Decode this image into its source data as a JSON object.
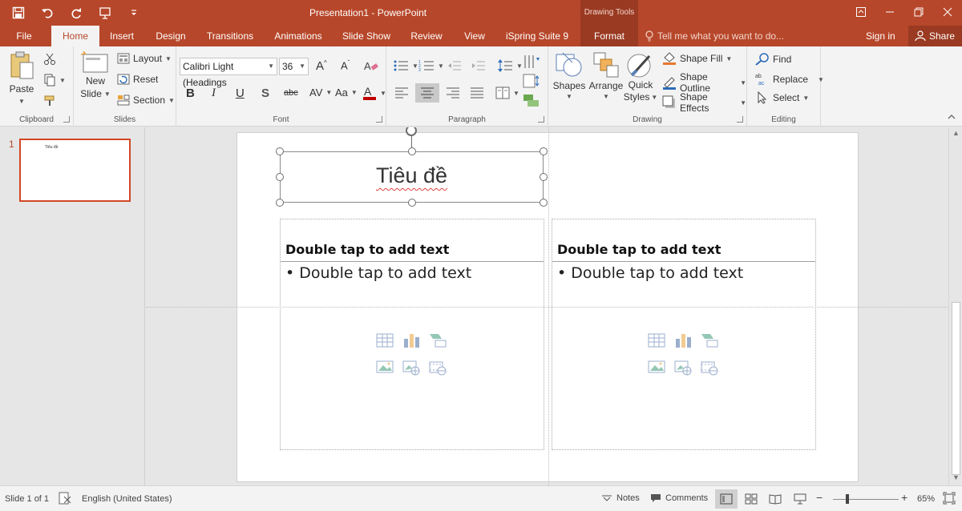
{
  "window": {
    "title": "Presentation1 - PowerPoint",
    "contextual_header": "Drawing Tools",
    "accent": "#b7472a"
  },
  "tabs": [
    {
      "label": "File"
    },
    {
      "label": "Home"
    },
    {
      "label": "Insert"
    },
    {
      "label": "Design"
    },
    {
      "label": "Transitions"
    },
    {
      "label": "Animations"
    },
    {
      "label": "Slide Show"
    },
    {
      "label": "Review"
    },
    {
      "label": "View"
    },
    {
      "label": "iSpring Suite 9"
    },
    {
      "label": "Format"
    }
  ],
  "tell_me": "Tell me what you want to do...",
  "sign_in": "Sign in",
  "share": "Share",
  "ribbon": {
    "clipboard": {
      "label": "Clipboard",
      "paste": "Paste"
    },
    "slides": {
      "label": "Slides",
      "new_slide_1": "New",
      "new_slide_2": "Slide",
      "layout": "Layout",
      "reset": "Reset",
      "section": "Section"
    },
    "font": {
      "label": "Font",
      "font_name": "Calibri Light (Headings",
      "font_size": "36",
      "underline_color": "#c00000"
    },
    "paragraph": {
      "label": "Paragraph"
    },
    "drawing": {
      "label": "Drawing",
      "shapes": "Shapes",
      "arrange": "Arrange",
      "quick_1": "Quick",
      "quick_2": "Styles",
      "shape_fill": "Shape Fill",
      "shape_outline": "Shape Outline",
      "shape_effects": "Shape Effects"
    },
    "editing": {
      "label": "Editing",
      "find": "Find",
      "replace": "Replace",
      "select": "Select"
    }
  },
  "thumbnails": [
    {
      "number": "1",
      "title": "Tiêu đề"
    }
  ],
  "slide": {
    "title": "Tiêu đề",
    "left": {
      "heading": "Double tap to add text",
      "bullet": "• Double tap to add text"
    },
    "right": {
      "heading": "Double tap to add text",
      "bullet": "• Double tap to add text"
    },
    "placeholder_icons": [
      "table-icon",
      "chart-icon",
      "smartart-icon",
      "picture-icon",
      "online-picture-icon",
      "video-icon"
    ]
  },
  "status": {
    "slide_info": "Slide 1 of 1",
    "language": "English (United States)",
    "notes": "Notes",
    "comments": "Comments",
    "zoom": "65%",
    "zoom_minus": "−",
    "zoom_plus": "+"
  }
}
